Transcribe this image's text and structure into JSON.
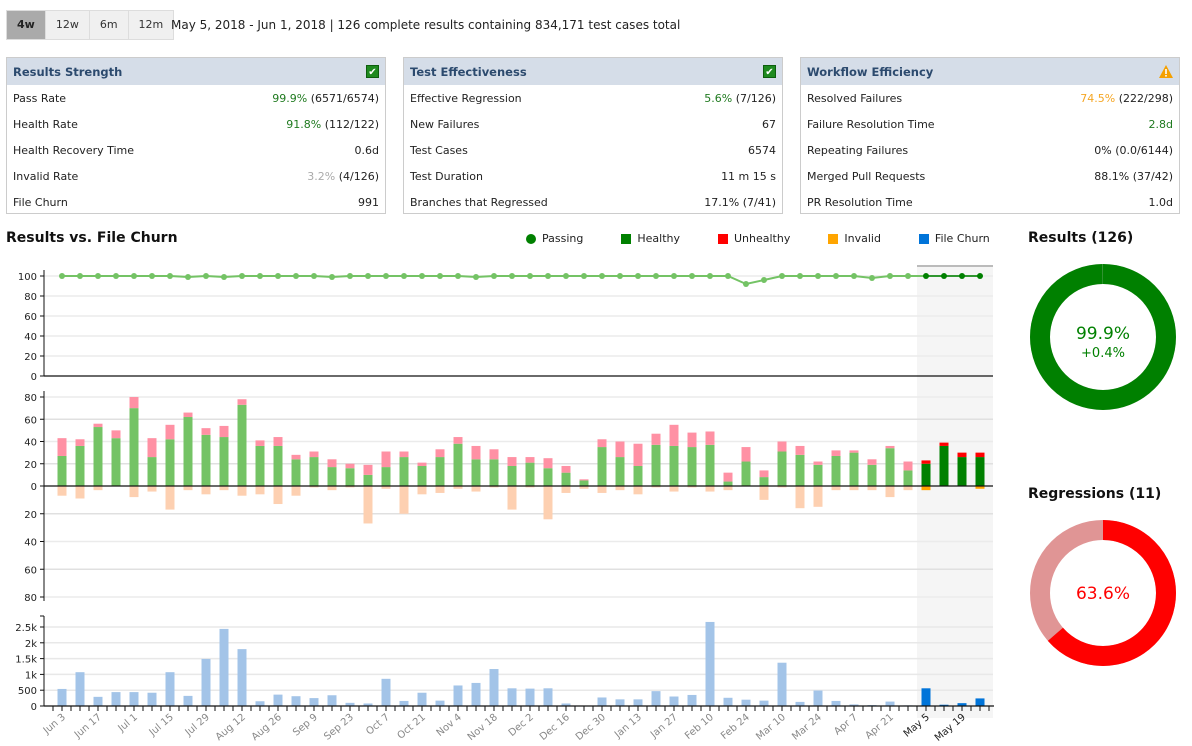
{
  "range_tabs": [
    {
      "label": "4w",
      "active": true
    },
    {
      "label": "12w",
      "active": false
    },
    {
      "label": "6m",
      "active": false
    },
    {
      "label": "12m",
      "active": false
    }
  ],
  "summary": "May 5, 2018 - Jun 1, 2018 | 126 complete results containing 834,171 test cases total",
  "cards": [
    {
      "title": "Results Strength",
      "status": "ok",
      "rows": [
        {
          "label": "Pass Rate",
          "value_highlight": "99.9%",
          "value_rest": " (6571/6574)",
          "tone": "good"
        },
        {
          "label": "Health Rate",
          "value_highlight": "91.8%",
          "value_rest": " (112/122)",
          "tone": "good"
        },
        {
          "label": "Health Recovery Time",
          "value_highlight": "",
          "value_rest": "0.6d",
          "tone": ""
        },
        {
          "label": "Invalid Rate",
          "value_highlight": "3.2%",
          "value_rest": " (4/126)",
          "tone": "muted"
        },
        {
          "label": "File Churn",
          "value_highlight": "",
          "value_rest": "991",
          "tone": ""
        }
      ]
    },
    {
      "title": "Test Effectiveness",
      "status": "ok",
      "rows": [
        {
          "label": "Effective Regression",
          "value_highlight": "5.6%",
          "value_rest": " (7/126)",
          "tone": "good"
        },
        {
          "label": "New Failures",
          "value_highlight": "",
          "value_rest": "67",
          "tone": ""
        },
        {
          "label": "Test Cases",
          "value_highlight": "",
          "value_rest": "6574",
          "tone": ""
        },
        {
          "label": "Test Duration",
          "value_highlight": "",
          "value_rest": "11 m 15 s",
          "tone": ""
        },
        {
          "label": "Branches that Regressed",
          "value_highlight": "",
          "value_rest": "17.1% (7/41)",
          "tone": ""
        }
      ]
    },
    {
      "title": "Workflow Efficiency",
      "status": "warning",
      "rows": [
        {
          "label": "Resolved Failures",
          "value_highlight": "74.5%",
          "value_rest": " (222/298)",
          "tone": "warn"
        },
        {
          "label": "Failure Resolution Time",
          "value_highlight": "2.8d",
          "value_rest": "",
          "tone": "good"
        },
        {
          "label": "Repeating Failures",
          "value_highlight": "",
          "value_rest": "0% (0.0/6144)",
          "tone": ""
        },
        {
          "label": "Merged Pull Requests",
          "value_highlight": "",
          "value_rest": "88.1% (37/42)",
          "tone": ""
        },
        {
          "label": "PR Resolution Time",
          "value_highlight": "",
          "value_rest": "1.0d",
          "tone": ""
        }
      ]
    }
  ],
  "chart_section_title": "Results vs. File Churn",
  "legend": [
    {
      "label": "Passing",
      "shape": "dot",
      "color": "#008000"
    },
    {
      "label": "Healthy",
      "shape": "square",
      "color": "#008000"
    },
    {
      "label": "Unhealthy",
      "shape": "square",
      "color": "#ff0000"
    },
    {
      "label": "Invalid",
      "shape": "square",
      "color": "#ffa500"
    },
    {
      "label": "File Churn",
      "shape": "square",
      "color": "#0074d9"
    }
  ],
  "colors": {
    "passing_line_past": "#74c365",
    "passing_line_current": "#008000",
    "healthy_past": "#74c365",
    "healthy_current": "#008000",
    "unhealthy_past": "#ff91a4",
    "unhealthy_current": "#ff0000",
    "invalid_past": "#fdd0b1",
    "invalid_current": "#ffa500",
    "churn_past": "#a3c4e8",
    "churn_current": "#0074d9"
  },
  "chart_data": {
    "type": "bar",
    "title": "Results vs. File Churn",
    "x_tick_labels": [
      "Jun 3",
      "Jun 17",
      "Jul 1",
      "Jul 15",
      "Jul 29",
      "Aug 12",
      "Aug 26",
      "Sep 9",
      "Sep 23",
      "Oct 7",
      "Oct 21",
      "Nov 4",
      "Nov 18",
      "Dec 2",
      "Dec 16",
      "Dec 30",
      "Jan 13",
      "Jan 27",
      "Feb 10",
      "Feb 24",
      "Mar 10",
      "Mar 24",
      "Apr 7",
      "Apr 21",
      "May 5",
      "May 19"
    ],
    "highlight_from_index": 48,
    "passing": {
      "ylabel": "",
      "ylim": [
        0,
        100
      ],
      "yticks": [
        0,
        20,
        40,
        60,
        80,
        100
      ],
      "values": [
        100,
        100,
        100,
        100,
        100,
        100,
        100,
        99,
        100,
        99,
        100,
        100,
        100,
        100,
        100,
        99,
        100,
        100,
        100,
        100,
        100,
        100,
        100,
        99,
        100,
        100,
        100,
        100,
        100,
        100,
        100,
        100,
        100,
        100,
        100,
        100,
        100,
        100,
        92,
        96,
        100,
        100,
        100,
        100,
        100,
        98,
        100,
        100,
        100,
        100,
        100,
        100
      ]
    },
    "results": {
      "ylim_up": [
        0,
        80
      ],
      "ylim_down": [
        0,
        80
      ],
      "yticks": [
        0,
        20,
        40,
        60,
        80
      ],
      "series": [
        {
          "name": "Healthy",
          "values": [
            27,
            36,
            53,
            43,
            70,
            26,
            42,
            62,
            46,
            44,
            73,
            36,
            36,
            24,
            26,
            17,
            16,
            10,
            17,
            26,
            18,
            26,
            38,
            24,
            24,
            18,
            21,
            16,
            12,
            5,
            35,
            26,
            18,
            37,
            36,
            35,
            37,
            4,
            22,
            8,
            31,
            28,
            19,
            27,
            30,
            19,
            34,
            14,
            20,
            36,
            26,
            26
          ]
        },
        {
          "name": "Unhealthy",
          "values": [
            16,
            6,
            3,
            7,
            10,
            17,
            13,
            4,
            6,
            10,
            5,
            5,
            8,
            4,
            5,
            7,
            4,
            9,
            14,
            5,
            3,
            7,
            6,
            12,
            9,
            8,
            5,
            9,
            6,
            1,
            7,
            14,
            20,
            10,
            19,
            13,
            12,
            8,
            13,
            6,
            9,
            8,
            3,
            5,
            2,
            5,
            2,
            8,
            3,
            3,
            4,
            4
          ]
        },
        {
          "name": "Invalid",
          "values": [
            7,
            9,
            3,
            0,
            8,
            4,
            17,
            3,
            6,
            3,
            7,
            6,
            13,
            7,
            1,
            3,
            1,
            27,
            2,
            20,
            6,
            5,
            2,
            4,
            1,
            17,
            1,
            24,
            5,
            2,
            5,
            3,
            6,
            1,
            4,
            1,
            4,
            3,
            0,
            10,
            1,
            16,
            15,
            3,
            3,
            3,
            8,
            3,
            3,
            0,
            0,
            2
          ]
        }
      ]
    },
    "churn": {
      "ylim": [
        0,
        2800
      ],
      "yticks": [
        0,
        500,
        1000,
        1500,
        2000,
        2500
      ],
      "ytick_labels": [
        "0",
        "500",
        "1k",
        "1.5k",
        "2k",
        "2.5k"
      ],
      "values": [
        540,
        1070,
        290,
        440,
        440,
        420,
        1070,
        320,
        1490,
        2440,
        1800,
        150,
        360,
        310,
        250,
        340,
        100,
        80,
        860,
        160,
        420,
        170,
        650,
        730,
        1170,
        560,
        550,
        560,
        80,
        10,
        270,
        210,
        210,
        470,
        300,
        350,
        2660,
        260,
        200,
        170,
        1370,
        130,
        490,
        160,
        50,
        30,
        140,
        20,
        560,
        40,
        90,
        240
      ]
    }
  },
  "donut_results": {
    "title": "Results (126)",
    "value_label": "99.9%",
    "delta_label": "+0.4%",
    "fraction": 0.999,
    "color": "#008000",
    "rest_color": "#cccccc"
  },
  "donut_regressions": {
    "title": "Regressions (11)",
    "value_label": "63.6%",
    "fraction": 0.636,
    "color": "#ff0000",
    "rest_color": "#e09595"
  }
}
